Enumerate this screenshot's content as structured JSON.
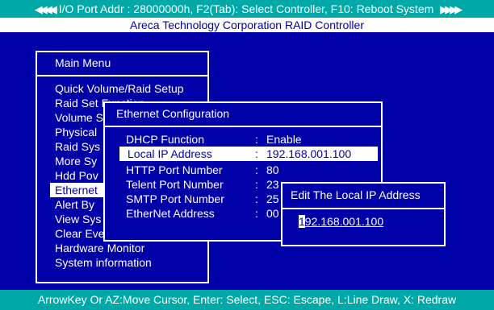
{
  "header": {
    "left_arrows": "◀◀◀◀",
    "status": "I/O Port Addr : 28000000h, F2(Tab): Select Controller, F10: Reboot System",
    "right_arrows": "▶▶▶▶",
    "subtitle": "Areca Technology Corporation RAID Controller"
  },
  "main_menu": {
    "title": "Main Menu",
    "items": [
      "Quick Volume/Raid Setup",
      "Raid Set Function",
      "Volume Set Function",
      "Physical Drives",
      "Raid System Function",
      "More System Functions",
      "Hdd Power Management",
      "Ethernet Configuration",
      "Alert By Mail Config",
      "View System Events",
      "Clear Event Buffer",
      "Hardware Monitor",
      "System information"
    ],
    "visible_labels": [
      "Quick Volume/Raid Setup",
      "Raid Set Function",
      "Volume S",
      "Physical",
      "Raid Sys",
      "More Sy",
      "Hdd Pov",
      "Ethernet",
      "Alert By",
      "View Sys",
      "Clear Event Buffer",
      "Hardware Monitor",
      "System information"
    ],
    "selected_index": 7
  },
  "ethernet_config": {
    "title": "Ethernet Configuration",
    "rows": [
      {
        "label": "DHCP Function",
        "sep": ":",
        "value": "Enable"
      },
      {
        "label": "Local IP Address",
        "sep": ":",
        "value": "192.168.001.100"
      },
      {
        "label": "HTTP  Port  Number",
        "sep": ":",
        "value": "80"
      },
      {
        "label": "Telent  Port  Number",
        "sep": ":",
        "value": "23"
      },
      {
        "label": "SMTP  Port  Number",
        "sep": ":",
        "value": "25"
      },
      {
        "label": "EtherNet  Address",
        "sep": ":",
        "value": "00"
      }
    ],
    "selected_index": 1
  },
  "edit_dialog": {
    "title": "Edit The Local IP Address",
    "cursor_char": "1",
    "value_rest": "92.168.001.100"
  },
  "footer": {
    "help": "ArrowKey Or AZ:Move Cursor, Enter: Select, ESC: Escape, L:Line Draw, X: Redraw"
  },
  "colors": {
    "background": "#0000a8",
    "bar": "#00a8a8",
    "highlight": "#ffffff"
  }
}
